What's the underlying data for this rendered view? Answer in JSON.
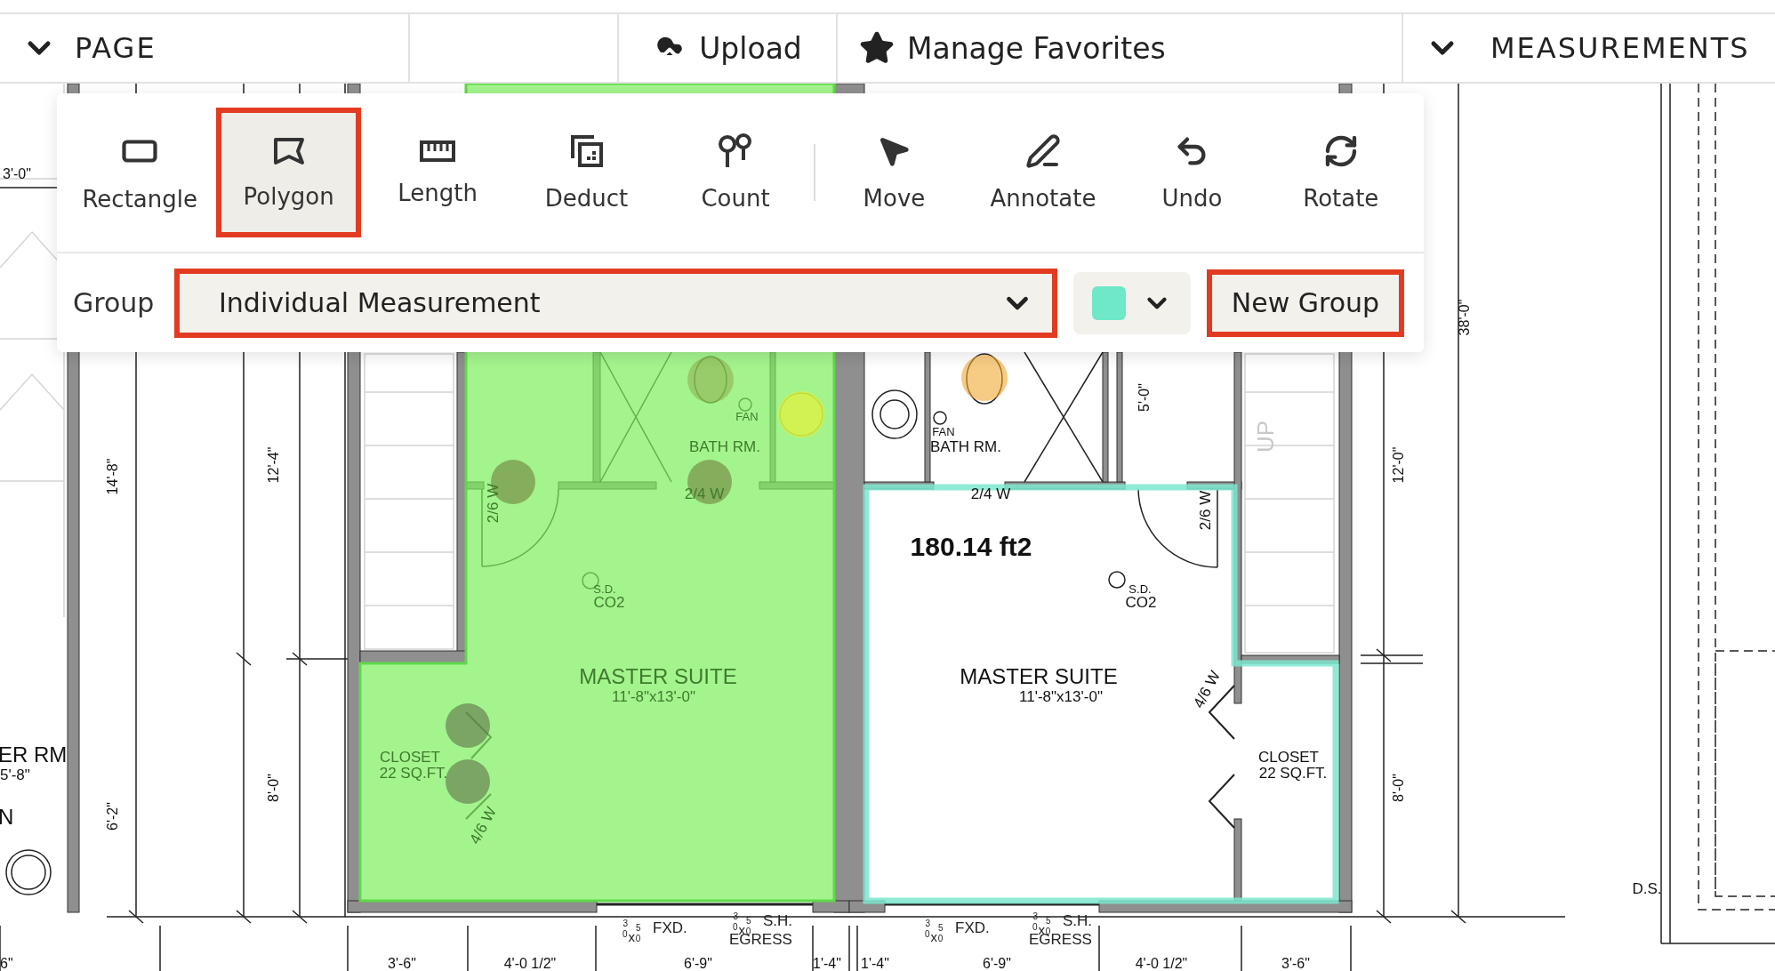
{
  "header": {
    "page_label": "PAGE",
    "upload": "Upload",
    "favorites": "Manage Favorites",
    "measurements_label": "MEASUREMENTS"
  },
  "toolbar": {
    "tool_groups": [
      [
        {
          "label": "Rectangle",
          "selected": false,
          "highlighted": false
        },
        {
          "label": "Polygon",
          "selected": true,
          "highlighted": true
        },
        {
          "label": "Length",
          "selected": false,
          "highlighted": false
        },
        {
          "label": "Deduct",
          "selected": false,
          "highlighted": false
        },
        {
          "label": "Count",
          "selected": false,
          "highlighted": false
        }
      ],
      [
        {
          "label": "Move",
          "selected": false,
          "highlighted": false
        },
        {
          "label": "Annotate",
          "selected": false,
          "highlighted": false
        },
        {
          "label": "Undo",
          "selected": false,
          "highlighted": false
        },
        {
          "label": "Rotate",
          "selected": false,
          "highlighted": false
        }
      ]
    ],
    "group": {
      "label": "Group",
      "value": "Individual Measurement",
      "highlighted": true
    },
    "color_picker": {
      "color": "#6ee8c6"
    },
    "new_group": {
      "label": "New Group",
      "highlighted": true
    }
  },
  "plan": {
    "labels": [
      {
        "text": "3'-0\"",
        "kind": "dimension"
      },
      {
        "text": "14'-8\"",
        "kind": "dimension"
      },
      {
        "text": "12'-4\"",
        "kind": "dimension"
      },
      {
        "text": "ER RM",
        "kind": "room"
      },
      {
        "text": "5'-8\"",
        "kind": "note"
      },
      {
        "text": "N",
        "kind": "room"
      },
      {
        "text": "6'-2\"",
        "kind": "dimension"
      },
      {
        "text": "8'-0\"",
        "kind": "dimension"
      },
      {
        "text": "6\"",
        "kind": "dimension"
      },
      {
        "text": "2/6 W",
        "kind": "note"
      },
      {
        "text": "FAN",
        "kind": "small"
      },
      {
        "text": "BATH RM.",
        "kind": "note"
      },
      {
        "text": "2/4 W",
        "kind": "note"
      },
      {
        "text": "S.D.",
        "kind": "small"
      },
      {
        "text": "CO2",
        "kind": "note"
      },
      {
        "text": "MASTER SUITE",
        "kind": "room"
      },
      {
        "text": "11'-8\"x13'-0\"",
        "kind": "note"
      },
      {
        "text": "CLOSET",
        "kind": "note"
      },
      {
        "text": "22 SQ.FT.",
        "kind": "note"
      },
      {
        "text": "4/6 W",
        "kind": "note"
      },
      {
        "text": "3'-6\"",
        "kind": "dimension"
      },
      {
        "text": "4'-0 1/2\"",
        "kind": "dimension"
      },
      {
        "text": "6'-9\"",
        "kind": "dimension"
      },
      {
        "text": "1'-4\"",
        "kind": "dimension"
      },
      {
        "text": "1'-4\"",
        "kind": "dimension"
      },
      {
        "text": "6'-9\"",
        "kind": "dimension"
      },
      {
        "text": "4'-0 1/2\"",
        "kind": "dimension"
      },
      {
        "text": "3'-6\"",
        "kind": "dimension"
      },
      {
        "text": "FAN",
        "kind": "small"
      },
      {
        "text": "BATH RM.",
        "kind": "note"
      },
      {
        "text": "5'-0\"",
        "kind": "dimension"
      },
      {
        "text": "UP",
        "kind": "faint"
      },
      {
        "text": "2/4 W",
        "kind": "note"
      },
      {
        "text": "2/6 W",
        "kind": "note"
      },
      {
        "text": "180.14 ft2",
        "kind": "area"
      },
      {
        "text": "S.D.",
        "kind": "small"
      },
      {
        "text": "CO2",
        "kind": "note"
      },
      {
        "text": "MASTER SUITE",
        "kind": "room"
      },
      {
        "text": "11'-8\"x13'-0\"",
        "kind": "note"
      },
      {
        "text": "4/6 W",
        "kind": "note"
      },
      {
        "text": "CLOSET",
        "kind": "note"
      },
      {
        "text": "22 SQ.FT.",
        "kind": "note"
      },
      {
        "text": "12'-0\"",
        "kind": "dimension"
      },
      {
        "text": "8'-0\"",
        "kind": "dimension"
      },
      {
        "text": "38'-0\"",
        "kind": "dimension"
      },
      {
        "text": "D.S.",
        "kind": "note"
      }
    ],
    "windows": [
      {
        "size": [
          [
            "3",
            "0"
          ],
          [
            "5",
            "0"
          ]
        ],
        "times": "x",
        "lines": [
          "FXD."
        ]
      },
      {
        "size": [
          [
            "3",
            "0"
          ],
          [
            "5",
            "0"
          ]
        ],
        "times": "x",
        "lines": [
          "S.H.",
          "EGRESS"
        ]
      },
      {
        "size": [
          [
            "3",
            "0"
          ],
          [
            "5",
            "0"
          ]
        ],
        "times": "x",
        "lines": [
          "FXD."
        ]
      },
      {
        "size": [
          [
            "3",
            "0"
          ],
          [
            "5",
            "0"
          ]
        ],
        "times": "x",
        "lines": [
          "S.H.",
          "EGRESS"
        ]
      }
    ]
  }
}
